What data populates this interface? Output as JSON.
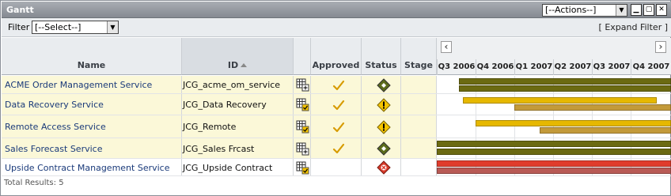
{
  "window": {
    "title": "Gantt"
  },
  "toolbar": {
    "actions_value": "[--Actions--]",
    "actions_arrow": "▼",
    "minimize": "▁",
    "restore": "▢",
    "close": "✕"
  },
  "filter": {
    "label": "Filter",
    "value": "[--Select--]",
    "arrow": "▼",
    "expand": "[ Expand Filter ]"
  },
  "columns": {
    "name": "Name",
    "id": "ID",
    "approved": "Approved",
    "status": "Status",
    "stage": "Stage"
  },
  "gantt": {
    "nav_prev": "‹",
    "nav_next": "›",
    "periods": [
      "Q3 2006",
      "Q4 2006",
      "Q1 2007",
      "Q2 2007",
      "Q3 2007",
      "Q4 2007"
    ]
  },
  "rows": [
    {
      "name": "ACME Order Management Service",
      "id": "JCG_acme_om_service",
      "doc_icon": "grid-add-icon",
      "approved": true,
      "status": "green-diamond",
      "stage": ""
    },
    {
      "name": "Data Recovery Service",
      "id": "JCG_Data Recovery",
      "doc_icon": "grid-check-icon",
      "approved": true,
      "status": "yellow-warning",
      "stage": ""
    },
    {
      "name": "Remote Access Service",
      "id": "JCG_Remote",
      "doc_icon": "grid-check-icon",
      "approved": true,
      "status": "yellow-warning",
      "stage": ""
    },
    {
      "name": "Sales Forecast Service",
      "id": "JCG_Sales Frcast",
      "doc_icon": "grid-add-icon",
      "approved": true,
      "status": "green-diamond",
      "stage": ""
    },
    {
      "name": "Upside Contract Management Service",
      "id": "JCG_Upside Contract",
      "doc_icon": "grid-check-icon",
      "approved": false,
      "status": "red-cross",
      "stage": ""
    }
  ],
  "colors": {
    "row_highlight": "#fbf8d8",
    "bar_green": "#6b6a12",
    "bar_yellow": "#e6b800",
    "bar_tan": "#c39a3a",
    "bar_red": "#e03c2c",
    "bar_red2": "#b85a55",
    "link": "#1a3a7a"
  },
  "footer": {
    "total": "Total Results: 5"
  }
}
